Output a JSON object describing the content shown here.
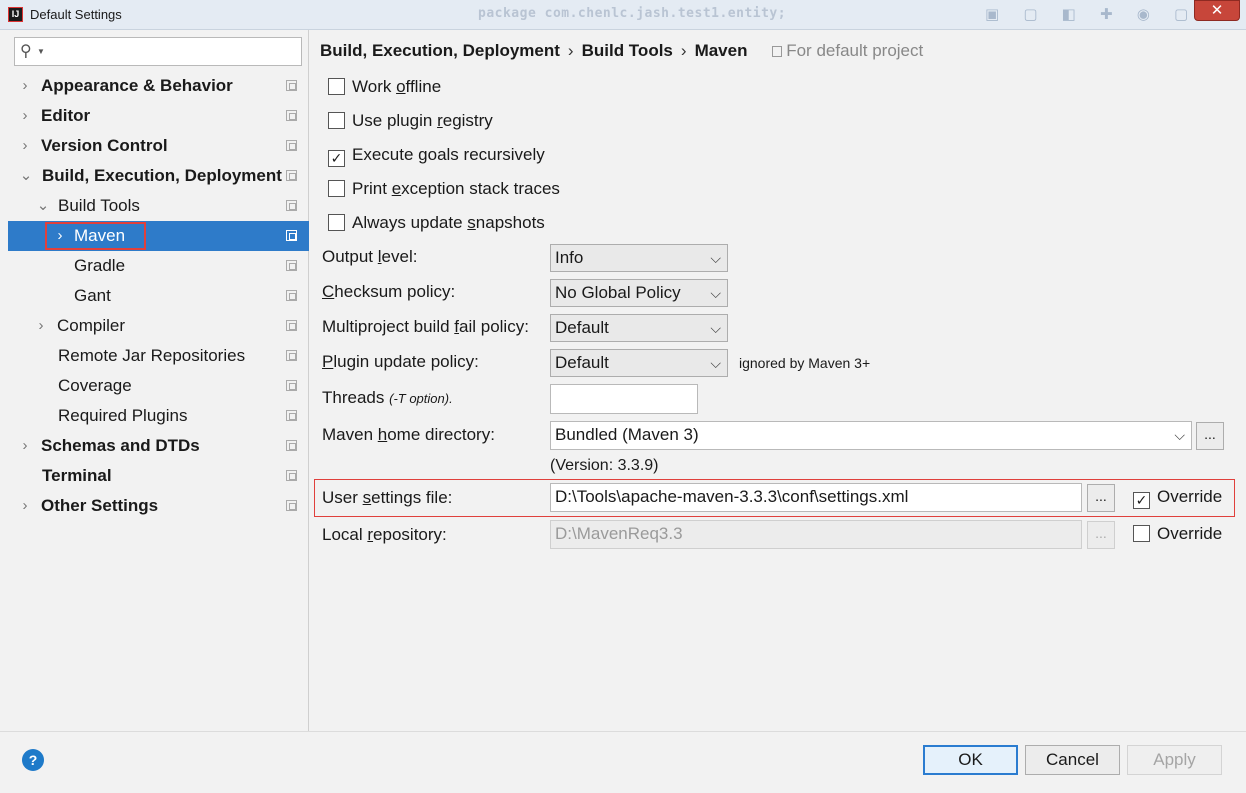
{
  "window": {
    "title": "Default Settings",
    "ghost_text": "package com.chenlc.jash.test1.entity;",
    "close_glyph": "✕",
    "ghost_icons": "▣ ▢ ◧ ✚ ◉ ▢"
  },
  "sidebar": {
    "search": {
      "placeholder": "",
      "value": "",
      "icon_glyph": "⚲",
      "dropdown_glyph": "▼"
    },
    "items": [
      {
        "label": "Appearance & Behavior",
        "arrow": "›"
      },
      {
        "label": "Editor",
        "arrow": "›"
      },
      {
        "label": "Version Control",
        "arrow": "›"
      },
      {
        "label": "Build, Execution, Deployment",
        "arrow": "⌄"
      },
      {
        "label": "Build Tools",
        "arrow": "⌄"
      },
      {
        "label": "Maven",
        "arrow": "›"
      },
      {
        "label": "Gradle"
      },
      {
        "label": "Gant"
      },
      {
        "label": "Compiler",
        "arrow": "›"
      },
      {
        "label": "Remote Jar Repositories"
      },
      {
        "label": "Coverage"
      },
      {
        "label": "Required Plugins"
      },
      {
        "label": "Schemas and DTDs",
        "arrow": "›"
      },
      {
        "label": "Terminal"
      },
      {
        "label": "Other Settings",
        "arrow": "›"
      }
    ]
  },
  "breadcrumb": {
    "parts": [
      "Build, Execution, Deployment",
      "Build Tools",
      "Maven"
    ],
    "separator": "›",
    "scope": "For default project"
  },
  "checkboxes": [
    {
      "pre": "Work ",
      "ul": "o",
      "post": "ffline",
      "checked": false
    },
    {
      "pre": "Use plugin ",
      "ul": "r",
      "post": "egistry",
      "checked": false
    },
    {
      "pre": "Execute ",
      "ul": "g",
      "post": "oals recursively",
      "checked": true
    },
    {
      "pre": "Print ",
      "ul": "e",
      "post": "xception stack traces",
      "checked": false
    },
    {
      "pre": "Always update ",
      "ul": "s",
      "post": "napshots",
      "checked": false
    }
  ],
  "check_mark": "✓",
  "chevron": "⌵",
  "form": {
    "output_level": {
      "pre": "Output ",
      "ul": "l",
      "post": "evel:",
      "value": "Info"
    },
    "checksum_policy": {
      "pre": "",
      "ul": "C",
      "post": "hecksum policy:",
      "value": "No Global Policy"
    },
    "multiproject": {
      "pre": "Multiproject build ",
      "ul": "f",
      "post": "ail policy:",
      "value": "Default"
    },
    "plugin_update": {
      "pre": "",
      "ul": "P",
      "post": "lugin update policy:",
      "value": "Default",
      "note": "ignored by Maven 3+"
    },
    "threads": {
      "label": "Threads",
      "hint": "(-T option).",
      "value": ""
    },
    "maven_home": {
      "pre": "Maven ",
      "ul": "h",
      "post": "ome directory:",
      "value": "Bundled (Maven 3)",
      "version": "(Version: 3.3.9)"
    },
    "user_settings": {
      "pre": "User ",
      "ul": "s",
      "post": "ettings file:",
      "value": "D:\\Tools\\apache-maven-3.3.3\\conf\\settings.xml",
      "override_label": "Override",
      "override": true
    },
    "local_repo": {
      "pre": "Local ",
      "ul": "r",
      "post": "epository:",
      "value": "D:\\MavenReq3.3",
      "override_label": "Override",
      "override": false
    },
    "browse_label": "..."
  },
  "footer": {
    "help_glyph": "?",
    "ok": "OK",
    "cancel": "Cancel",
    "apply": "Apply"
  }
}
